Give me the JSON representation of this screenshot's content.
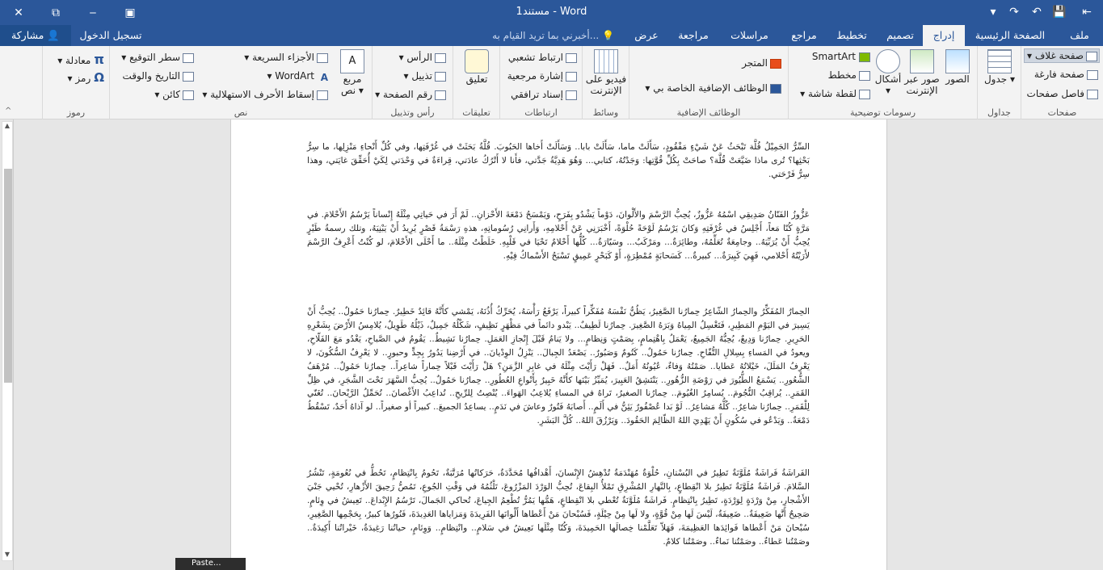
{
  "title": "مستند1 - Word",
  "win": {
    "back": "⇤",
    "minimize": "‒",
    "restore": "⧉",
    "close": "✕",
    "quick": [
      "↶",
      "↷",
      "💾"
    ]
  },
  "tabs": {
    "file": "ملف",
    "home": "الصفحة الرئيسية",
    "insert": "إدراج",
    "design": "تصميم",
    "layout": "تخطيط",
    "references": "مراجع",
    "mailings": "مراسلات",
    "review": "مراجعة",
    "view": "عرض"
  },
  "tell_me": "أخبرني بما تريد القيام به...",
  "signin": "تسجيل الدخول",
  "share": "مشاركة",
  "ribbon": {
    "pages": {
      "label": "صفحات",
      "cover": "صفحة غلاف",
      "blank": "صفحة فارغة",
      "break": "فاصل صفحات"
    },
    "tables": {
      "label": "جداول",
      "table": "جدول"
    },
    "illustrations": {
      "label": "رسومات توضيحية",
      "pictures": "الصور",
      "online": "صور عبر الإنترنت",
      "shapes": "أشكال",
      "smartart": "SmartArt",
      "chart": "مخطط",
      "screenshot": "لقطة شاشة"
    },
    "addins": {
      "label": "الوظائف الإضافية",
      "store": "المتجر",
      "myaddins": "الوظائف الإضافية الخاصة بي"
    },
    "media": {
      "label": "وسائط",
      "video": "فيديو على الإنترنت"
    },
    "links": {
      "label": "ارتباطات",
      "hyperlink": "ارتباط تشعبي",
      "bookmark": "إشارة مرجعية",
      "crossref": "إسناد ترافقي"
    },
    "comments": {
      "label": "تعليقات",
      "comment": "تعليق"
    },
    "headerfooter": {
      "label": "رأس وتذييل",
      "header": "الرأس",
      "footer": "تذييل",
      "pagenum": "رقم الصفحة"
    },
    "text": {
      "label": "نص",
      "textbox": "مربع نص",
      "quickparts": "الأجزاء السريعة",
      "wordart": "WordArt",
      "dropcap": "إسقاط الأحرف الاستهلالية",
      "sigline": "سطر التوقيع",
      "datetime": "التاريخ والوقت",
      "object": "كائن"
    },
    "symbols": {
      "label": "رموز",
      "equation": "معادلة",
      "symbol": "رمز"
    }
  },
  "doc": {
    "p1": "السِّرُّ الجَمِيْلُ قُلَّة تَبْحَثُ عَنْ شَيْءٍ مَفْقُودٍ، سَأَلَتْ ماما، سَأَلَتْ بابا.. وَسَأَلَتْ أَخاها الحَبُوبَ. قُلَّةُ بَحَثَتْ في غُرْفَتِها، وفي كُلِّ أَنْحاءِ مَنْزِلِها، ما سِرُّ بَحْثِها؟ تُرى ماذا ضَيَّعَتْ قُلَّة؟ صاحَتْ بِكُلِّ قُوَّتِها: وَجَدْتُهُ، كتابي... وَهُوَ هَدِيَّةُ جَدَّتي، فأَنا لا أَتْرُكُ عادَتي، قِراءَةٌ في وَحْدَتي لِكَيْ أُحَقِّقَ غايَتي، وهذا سِرُّ فَرْحَتي.",
    "p2": "عَزُّوزُ الفَنّانُ صَدِيقِي اسْمُهُ عَزُّوزٌ، يُحِبُّ الرَّسْمَ والأَلْوانَ، دَوْماً يَشْدُو بِفَرَحٍ، وَيَمْسَحُ دَمْعَةَ الأَحْزانِ.. لَمْ أَرَ في حَياتِي مِثْلَهُ إِنْساناً يَرْسُمُ الأَحْلامَ. في مَرَّةٍ كُنّا مَعاً، أَجْلِسُ في غُرْفَتِهِ وَكانَ يَرْسُمُ لَوْحَةً حُلْوَةً، أَخْبَرَنِي عَنْ أَحْلامِهِ، وَأَرانِي رُسُوماتِهِ، هذهِ رَسْمَةُ قَصْرٍ يُرِيدُ أَنْ يَبْنِيَهُ، وتلك رسمةُ طَيْرٍ يُحِبُّ أَنْ يُرَبِّيَهُ.. وجامِعَةٌ تُعَلِّمُهُ، وطائِرَةٌ... ومَرْكَبٌ... وسَيّارَةٌ... كُلُّها أَحْلامٌ تَحْيَا في قَلْبِهِ. خَلَطْتُ مِثْلَهُ.. ما أَحْلَى الأَحْلامَ، لو كُنْتُ أَعْرِفُ الرَّسْمَ لأَرَيْتُهُ أَحْلامي، فَهِيَ كَبِيرَةٌ... كبيرةٌ... كَسَحابَةٍ مُمْطِرَةٍ، أَوْ كَبَحْرٍ عَمِيقٍ تَسْبَحُ الأَسْماكُ فِيْهِ.",
    "p3": "الحِمارُ المُفَكِّرُ والحِمارُ الشّاعِرُ حِمارُنا الصَّغِيرُ، يَظُنُّ نَفْسَهُ مُفَكِّراً كبيراً، يَرْفَعُ رَأْسَهُ، يُحَرِّكُ أُذُنَهُ، يَمْشي كأَنَّهُ قائِدٌ خَطِيرٌ. حِمارُنا حَمُولٌ.. يُحِبُّ أَنْ يَسِيرَ في اليَوْمِ المَطِيرِ، فَتَغْسِلُ المِياهُ وَبَرَهُ الصَّغِيرَ. حِمارُنا لَطِيفٌ.. يَبْدو دائماً في مَظْهَرٍ نَظِيفٍ، شَكْلُهُ جَمِيلٌ، ذَيْلُهُ طَوِيلٌ، يُلامِسُ الأَرْضَ بِشَعْرِهِ الحَرِيرِ. حِمارُنا وَدِيعٌ، يُحِبُّهُ الجَمِيعُ، يَعْمَلُ بِاهْتِمامٍ، بِصَمْتٍ وَنِظامٍ... ولا يَنامُ قَبْلَ إِنْجازِ العَمَلِ. حِمارُنا نَشِيطٌ.. يَقُومُ في الصَّباحِ، يَغْدُو مَعَ الفَلّاحِ، ويعودُ في المَساءِ بِسِلالِ التُّفّاحِ. حِمارُنا حَمُولٌ.. كَتُومٌ وَصَبُورٌ.. يَصْعَدُ الجِبالَ.. يَنْزِلُ الوِدْيانَ.. في أَرْضِنا يَدُورُ بِجِدٍّ وحبورٍ.. لا يَعْرِفُ السُّكُونَ، لا يَعْرِفُ المَلَلَ، خَيْلاتُهُ عَطايا.. صَمْتُهُ وَفاءٌ، عُيُونُهُ أَمَلٌ.. فَهَلْ رَأَيْتَ مِثْلَهُ في غابِرِ الزَّمَنِ؟ هَلْ رَأَيْتَ قَبْلاً حِماراً شاعِراً.. حِمارُنا حَمُولٌ.. مُرْهَفُ الشُّعُورِ.. يَسْمَعُ الطُّيُورَ في رَوْضَةِ الزُّهُورِ.. يَنْتَشِقُ العَبِيرَ، يُمَيِّزُ بَيْنَها كأَنَّهُ خَبِيرٌ بِأَنْواعِ العُطُورِ.. حِمارُنا حَمُولٌ.. يُحِبُّ السَّهَرَ تَحْتَ الشَّجَرِ، في ظِلِّ القَمَرِ.. يُراقِبُ النُّجُومَ.. يُسامِرُ الغُيُومَ.. حِمارُنا الصغيرُ، تَراهُ في المساءِ يُلاعِبُ الهَواءَ.. يُنْصِتُ لِلرِّيحِ.. تُداعِبُ الأَغْصانَ.. تُحَمِّلُ الرَّيْحانَ.. تُغَنّي لِلْقَمَرِ.. حِمارُنا شاعِرٌ.. كُلُّهُ مَشاعِرُ.. لَوْ بَدا عُصْفُورٌ يَئِنُّ في أَلَمٍ.. أَصابَهُ فَتُورٌ وعاشَ في نَدَمٍ.. يساعِدُ الجميعَ.. كبيراً أو صغيراً.. لو آذاهُ أَحَدٌ، تَسْقُطُ دَمْعَةٌ.. وَيَدْعُو في سُكُونٍ أَنْ يَهْدِيَ اللهُ الظّالِمَ الحَقُودَ.. وَيَرْزُقَ اللهُ.. كُلَّ البَشَرِ.",
    "p4": "الفَراشَةُ فَراشَةٌ مُلَوَّنَةٌ تَطِيرُ في البُسْتانِ، حُلْوَةٌ مُهَنْدَمَةٌ تُدْهِشُ الإِنْسانَ، أَهْدافُها مُحَدَّدَةٌ، حَرَكاتُها مُرَتَّبَةٌ، تَحُومُ بِانْتِظامٍ، تَحُطُّ في نُعُومَةٍ، تَنْشُرُ السَّلامَ. فَراشَةٌ مُلَوَّنَةٌ تَطِيرُ بلا انْقِطاعٍ، بِالنَّهارِ المُشْرِقِ تَمْلأُ البِقاعَ، تُحِبُّ الوَرْدَ المَزْرُوعَ، تَلْثُمُهُ في وَقْتِ الجُوعِ، تَمُصُّ رَحِيقَ الأَزْهارِ، تُحْيي جَنْيَ الأَشْجارِ، مِنْ وَرْدَةٍ لِوَرْدَةٍ، تَطِيرُ بِانْتِظامٍ. فَراشَةٌ مُلَوَّنَةٌ تُعْطي بلا انْقِطاعٍ، هَمُّها يَمُرُّ تُطْعِمُ الجِياعَ، تُحاكي الجَمالَ، تَرْسُمُ الإِبْداعَ.. تَعِيشُ في وِئامٍ. صَحِيحٌ أَنَّها ضَعِيفَةٌ.. ضَعِيفَةٌ، لَيْسَ لَها مِنْ قُوَّةٍ، ولا لَها مِنْ حِيْلَةٍ، فَسُبْحانَ مَنْ أَعْطاها أَلْوانَها الفَرِيدَةَ وَمَزاياها العَدِيدَةَ، فَنُورُها كبيرٌ، بِحَجْمِها الصَّغِيرِ، سُبْحانَ مَنْ أَعْطاها فَوائِدَها العَظِيمَةَ، فَهَلاّ تَعَلَّمْنا خِصالَها الحَمِيدَةَ، وَكُنّا مِثْلَها نَعِيشُ في سَلامٍ.. وانْتِظامٍ.. وَوِئامٍ، حياتُنا رَغِيدَةٌ، خَيْراتُنا أَكِيدَةٌ.. وصَمْتُنا عَطاءٌ.. وصَمْتُنا نَماءٌ.. وصَمْتُنا كلامٌ."
  },
  "tooltip": "Paste..."
}
